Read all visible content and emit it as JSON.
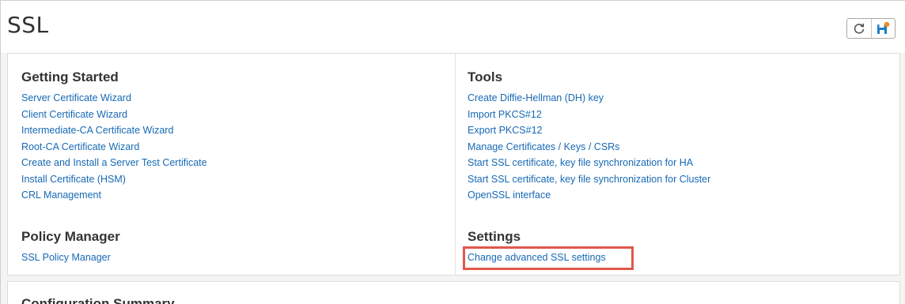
{
  "page": {
    "title": "SSL"
  },
  "toolbar": {
    "refresh_icon": "refresh-icon",
    "save_icon": "save-icon",
    "badge_color": "#f08a24"
  },
  "getting_started": {
    "heading": "Getting Started",
    "links": [
      "Server Certificate Wizard",
      "Client Certificate Wizard",
      "Intermediate-CA Certificate Wizard",
      "Root-CA Certificate Wizard",
      "Create and Install a Server Test Certificate",
      "Install Certificate (HSM)",
      "CRL Management"
    ]
  },
  "policy_manager": {
    "heading": "Policy Manager",
    "links": [
      "SSL Policy Manager"
    ]
  },
  "tools": {
    "heading": "Tools",
    "links": [
      "Create Diffie-Hellman (DH) key",
      "Import PKCS#12",
      "Export PKCS#12",
      "Manage Certificates / Keys / CSRs",
      "Start SSL certificate, key file synchronization for HA",
      "Start SSL certificate, key file synchronization for Cluster",
      "OpenSSL interface"
    ]
  },
  "settings": {
    "heading": "Settings",
    "links": [
      "Change advanced SSL settings"
    ]
  },
  "summary": {
    "heading": "Configuration Summary"
  },
  "colors": {
    "link": "#1769b5",
    "highlight": "#e2574c"
  }
}
